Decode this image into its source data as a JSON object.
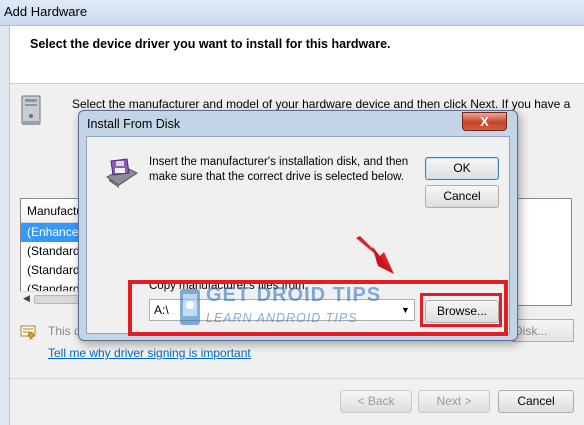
{
  "wizard": {
    "title": "Add Hardware",
    "heading": "Select the device driver you want to install for this hardware.",
    "instruction": "Select the manufacturer and model of your hardware device and then click Next. If you have a",
    "list": {
      "column_header": "Manufacturer",
      "items": [
        "(Enhanced",
        "(Standard",
        "(Standard",
        "(Standard"
      ],
      "selected_index": 0
    },
    "signed_text": "This d",
    "signing_link": "Tell me why driver signing is important",
    "have_disk_label": "Disk...",
    "buttons": {
      "back": "< Back",
      "next": "Next >",
      "cancel": "Cancel"
    }
  },
  "dialog": {
    "title": "Install From Disk",
    "close_label": "X",
    "message": "Insert the manufacturer's installation disk, and then make sure that the correct drive is selected below.",
    "ok_label": "OK",
    "cancel_label": "Cancel",
    "copy_label": "Copy manufacturer's files from:",
    "path_value": "A:\\",
    "browse_label": "Browse..."
  },
  "watermark": {
    "line1": "GET DROID TIPS",
    "line2": "LEARN ANDROID TIPS"
  },
  "colors": {
    "annotation_red": "#e31d24",
    "selection_blue": "#3399ff",
    "link_blue": "#0066cc",
    "watermark_blue": "#1e6fb8"
  },
  "icons": [
    "hardware-device-icon",
    "floppy-disk-icon",
    "certificate-icon",
    "chevron-down-icon",
    "close-icon",
    "droid-logo-icon"
  ]
}
